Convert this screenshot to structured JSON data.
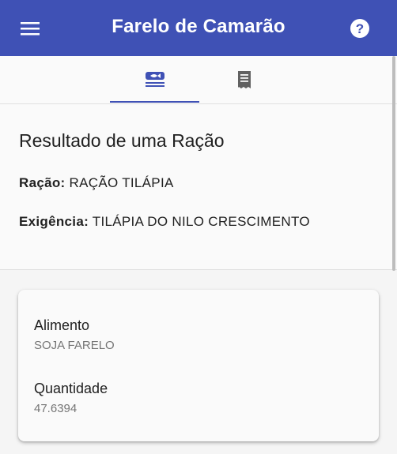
{
  "app_bar": {
    "title": "Farelo de Camarão",
    "menu_icon": "menu-icon",
    "help_icon": "help-icon"
  },
  "tabs": [
    {
      "icon": "fish-food-icon",
      "selected": true
    },
    {
      "icon": "receipt-icon",
      "selected": false
    }
  ],
  "result": {
    "heading": "Resultado de uma Ração",
    "racao_label": "Ração:",
    "racao_value": "RAÇÃO TILÁPIA",
    "exigencia_label": "Exigência:",
    "exigencia_value": "TILÁPIA DO NILO CRESCIMENTO"
  },
  "item_card": {
    "alimento_label": "Alimento",
    "alimento_value": "SOJA FARELO",
    "quantidade_label": "Quantidade",
    "quantidade_value": "47.6394"
  },
  "colors": {
    "primary": "#3f51b5",
    "background": "#fafafa",
    "text": "#212121",
    "secondary_text": "#757575"
  }
}
